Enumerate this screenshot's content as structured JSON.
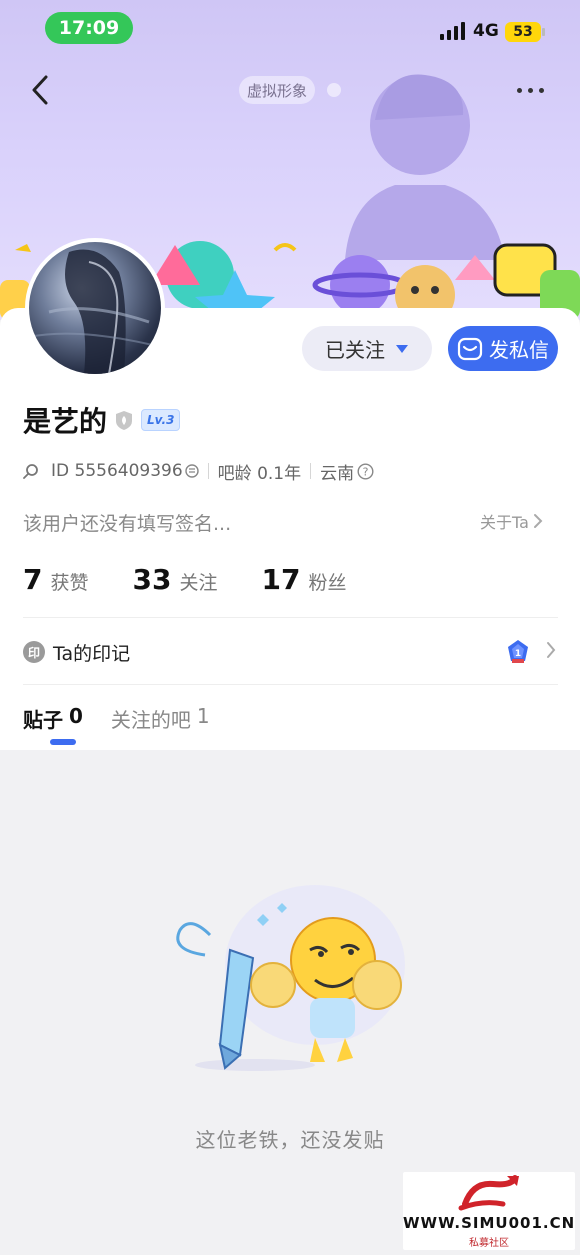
{
  "status_bar": {
    "time": "17:09",
    "network": "4G",
    "battery": "53"
  },
  "nav": {
    "virtual_tag": "虚拟形象"
  },
  "profile": {
    "username": "是艺的",
    "level": "Lv.3",
    "id_text": "ID 5556409396",
    "bar_age": "吧龄 0.1年",
    "location": "云南",
    "signature": "该用户还没有填写签名...",
    "about_link": "关于Ta"
  },
  "actions": {
    "follow_label": "已关注",
    "dm_label": "发私信"
  },
  "stats": [
    {
      "num": "7",
      "label": "获赞"
    },
    {
      "num": "33",
      "label": "关注"
    },
    {
      "num": "17",
      "label": "粉丝"
    }
  ],
  "seal": {
    "icon_text": "印",
    "label": "Ta的印记"
  },
  "tabs": [
    {
      "label": "贴子",
      "count": "0"
    },
    {
      "label": "关注的吧",
      "count": "1"
    }
  ],
  "empty_state": {
    "text": "这位老铁，还没发贴"
  },
  "watermark": {
    "text": "WWW.SIMU001.CN",
    "sub": "私募社区"
  },
  "colors": {
    "accent": "#3d6cf0",
    "banner": "#d9d1fb",
    "status_green": "#34c759"
  }
}
